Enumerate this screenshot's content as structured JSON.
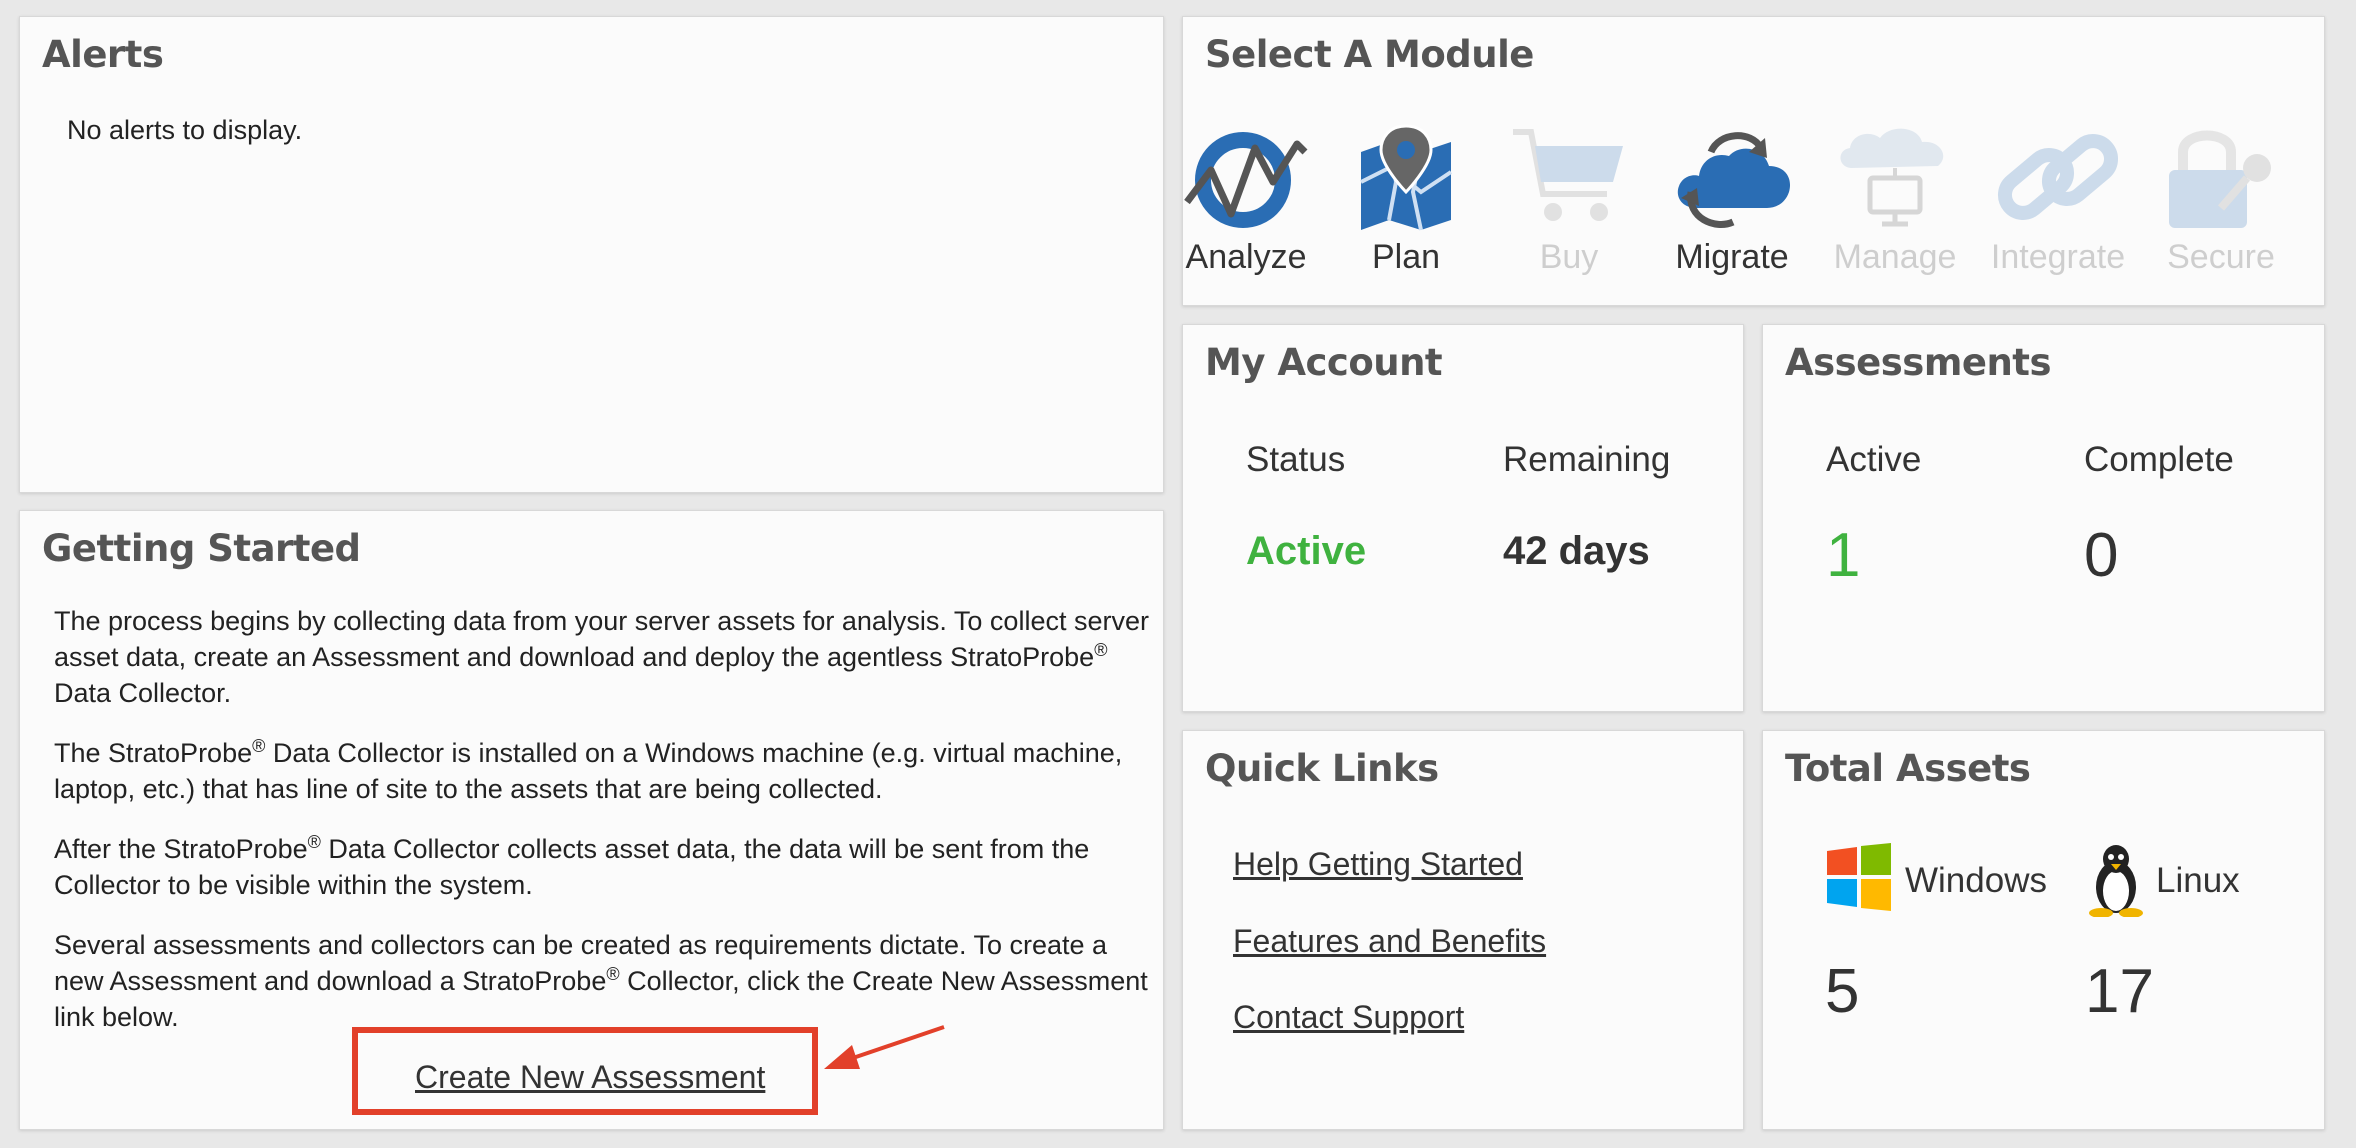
{
  "alerts": {
    "title": "Alerts",
    "message": "No alerts to display."
  },
  "modules": {
    "title": "Select A Module",
    "items": [
      {
        "label": "Analyze",
        "icon": "analyze-icon",
        "enabled": true
      },
      {
        "label": "Plan",
        "icon": "map-pin-icon",
        "enabled": true
      },
      {
        "label": "Buy",
        "icon": "cart-icon",
        "enabled": false
      },
      {
        "label": "Migrate",
        "icon": "cloud-sync-icon",
        "enabled": true
      },
      {
        "label": "Manage",
        "icon": "cloud-monitor-icon",
        "enabled": false
      },
      {
        "label": "Integrate",
        "icon": "chain-link-icon",
        "enabled": false
      },
      {
        "label": "Secure",
        "icon": "lock-key-icon",
        "enabled": false
      }
    ]
  },
  "account": {
    "title": "My Account",
    "status_label": "Status",
    "remaining_label": "Remaining",
    "status_value": "Active",
    "remaining_value": "42 days"
  },
  "assessments": {
    "title": "Assessments",
    "active_label": "Active",
    "complete_label": "Complete",
    "active_value": "1",
    "complete_value": "0"
  },
  "getting_started": {
    "title": "Getting Started",
    "p1a": "The process begins by collecting data from your server assets for analysis. To collect server asset data, create an Assessment and download and deploy the agentless StratoProbe",
    "p1b": " Data Collector.",
    "p2a": "The StratoProbe",
    "p2b": " Data Collector is installed on a Windows machine (e.g. virtual machine, laptop, etc.) that has line of site to the assets that are being collected.",
    "p3a": "After the StratoProbe",
    "p3b": " Data Collector collects asset data, the data will be sent from the Collector to be visible within the system.",
    "p4a": "Several assessments and collectors can be created as requirements dictate. To create a new Assessment and download a StratoProbe",
    "p4b": " Collector, click the Create New Assessment link below.",
    "registered": "®",
    "create_link": "Create New Assessment"
  },
  "quick_links": {
    "title": "Quick Links",
    "links": [
      "Help Getting Started",
      "Features and Benefits",
      "Contact Support"
    ]
  },
  "total_assets": {
    "title": "Total Assets",
    "windows_label": "Windows",
    "linux_label": "Linux",
    "windows_count": "5",
    "linux_count": "17"
  },
  "colors": {
    "active_green": "#3fb23f",
    "link_highlight_red": "#e2402a",
    "module_blue": "#2a6db4"
  }
}
